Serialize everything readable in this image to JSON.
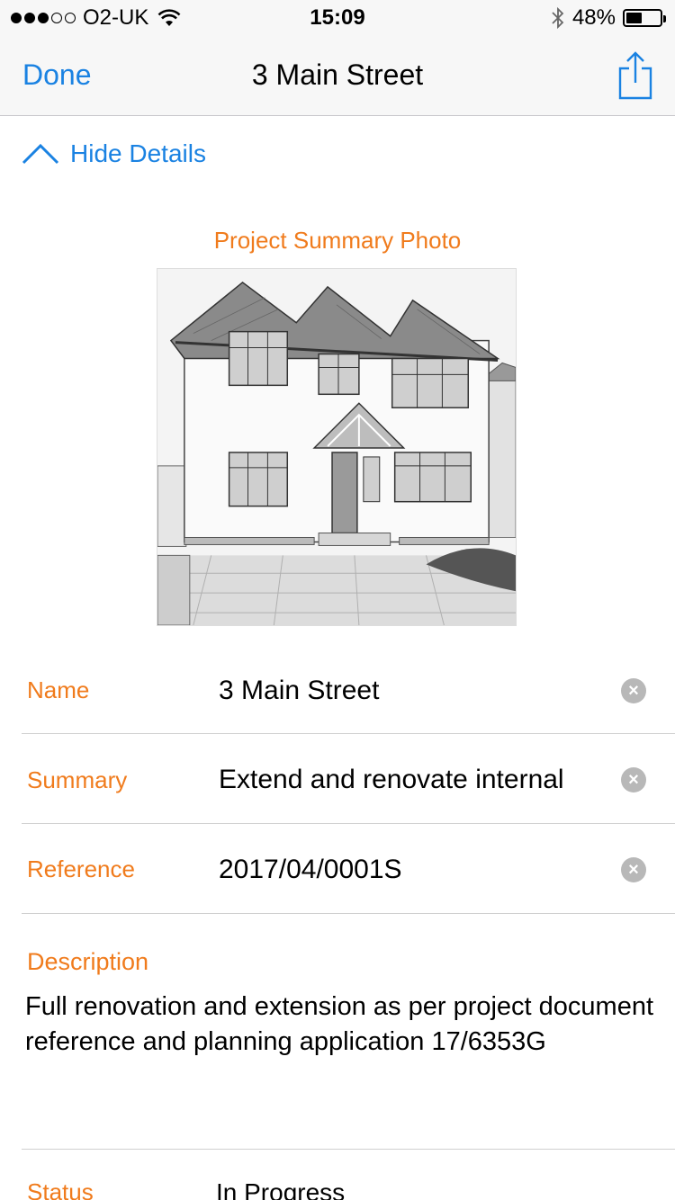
{
  "status_bar": {
    "carrier": "O2-UK",
    "time": "15:09",
    "battery_percent": "48%",
    "battery_level": 0.48,
    "signal_bars": 3
  },
  "nav": {
    "done_label": "Done",
    "title": "3 Main Street"
  },
  "details_toggle": "Hide Details",
  "photo": {
    "label": "Project Summary Photo"
  },
  "fields": [
    {
      "label": "Name",
      "value": "3 Main Street"
    },
    {
      "label": "Summary",
      "value": "Extend and renovate internal"
    },
    {
      "label": "Reference",
      "value": "2017/04/0001S"
    }
  ],
  "description": {
    "label": "Description",
    "text": "Full renovation and extension as per project document reference and planning application 17/6353G"
  },
  "status": {
    "label": "Status",
    "value": "In Progress"
  },
  "colors": {
    "accent_blue": "#1a82e2",
    "label_orange": "#f07b1c"
  }
}
